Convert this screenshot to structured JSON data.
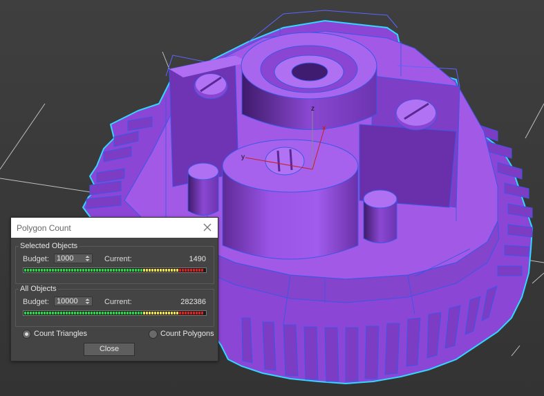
{
  "dialog": {
    "title": "Polygon Count",
    "close_icon": "close-icon",
    "selected": {
      "legend": "Selected Objects",
      "budget_label": "Budget:",
      "budget_value": "1000",
      "current_label": "Current:",
      "current_value": "1490"
    },
    "all": {
      "legend": "All Objects",
      "budget_label": "Budget:",
      "budget_value": "10000",
      "current_label": "Current:",
      "current_value": "282386"
    },
    "count_triangles": "Count Triangles",
    "count_polygons": "Count Polygons",
    "selected_mode": "triangles",
    "close_label": "Close"
  },
  "viewport": {
    "axis_z": "z",
    "axis_y": "y",
    "axis_x": "x",
    "object_color": "#9b4fe0",
    "selection_color": "#32d6ff",
    "wire_color": "#3b56e8"
  }
}
